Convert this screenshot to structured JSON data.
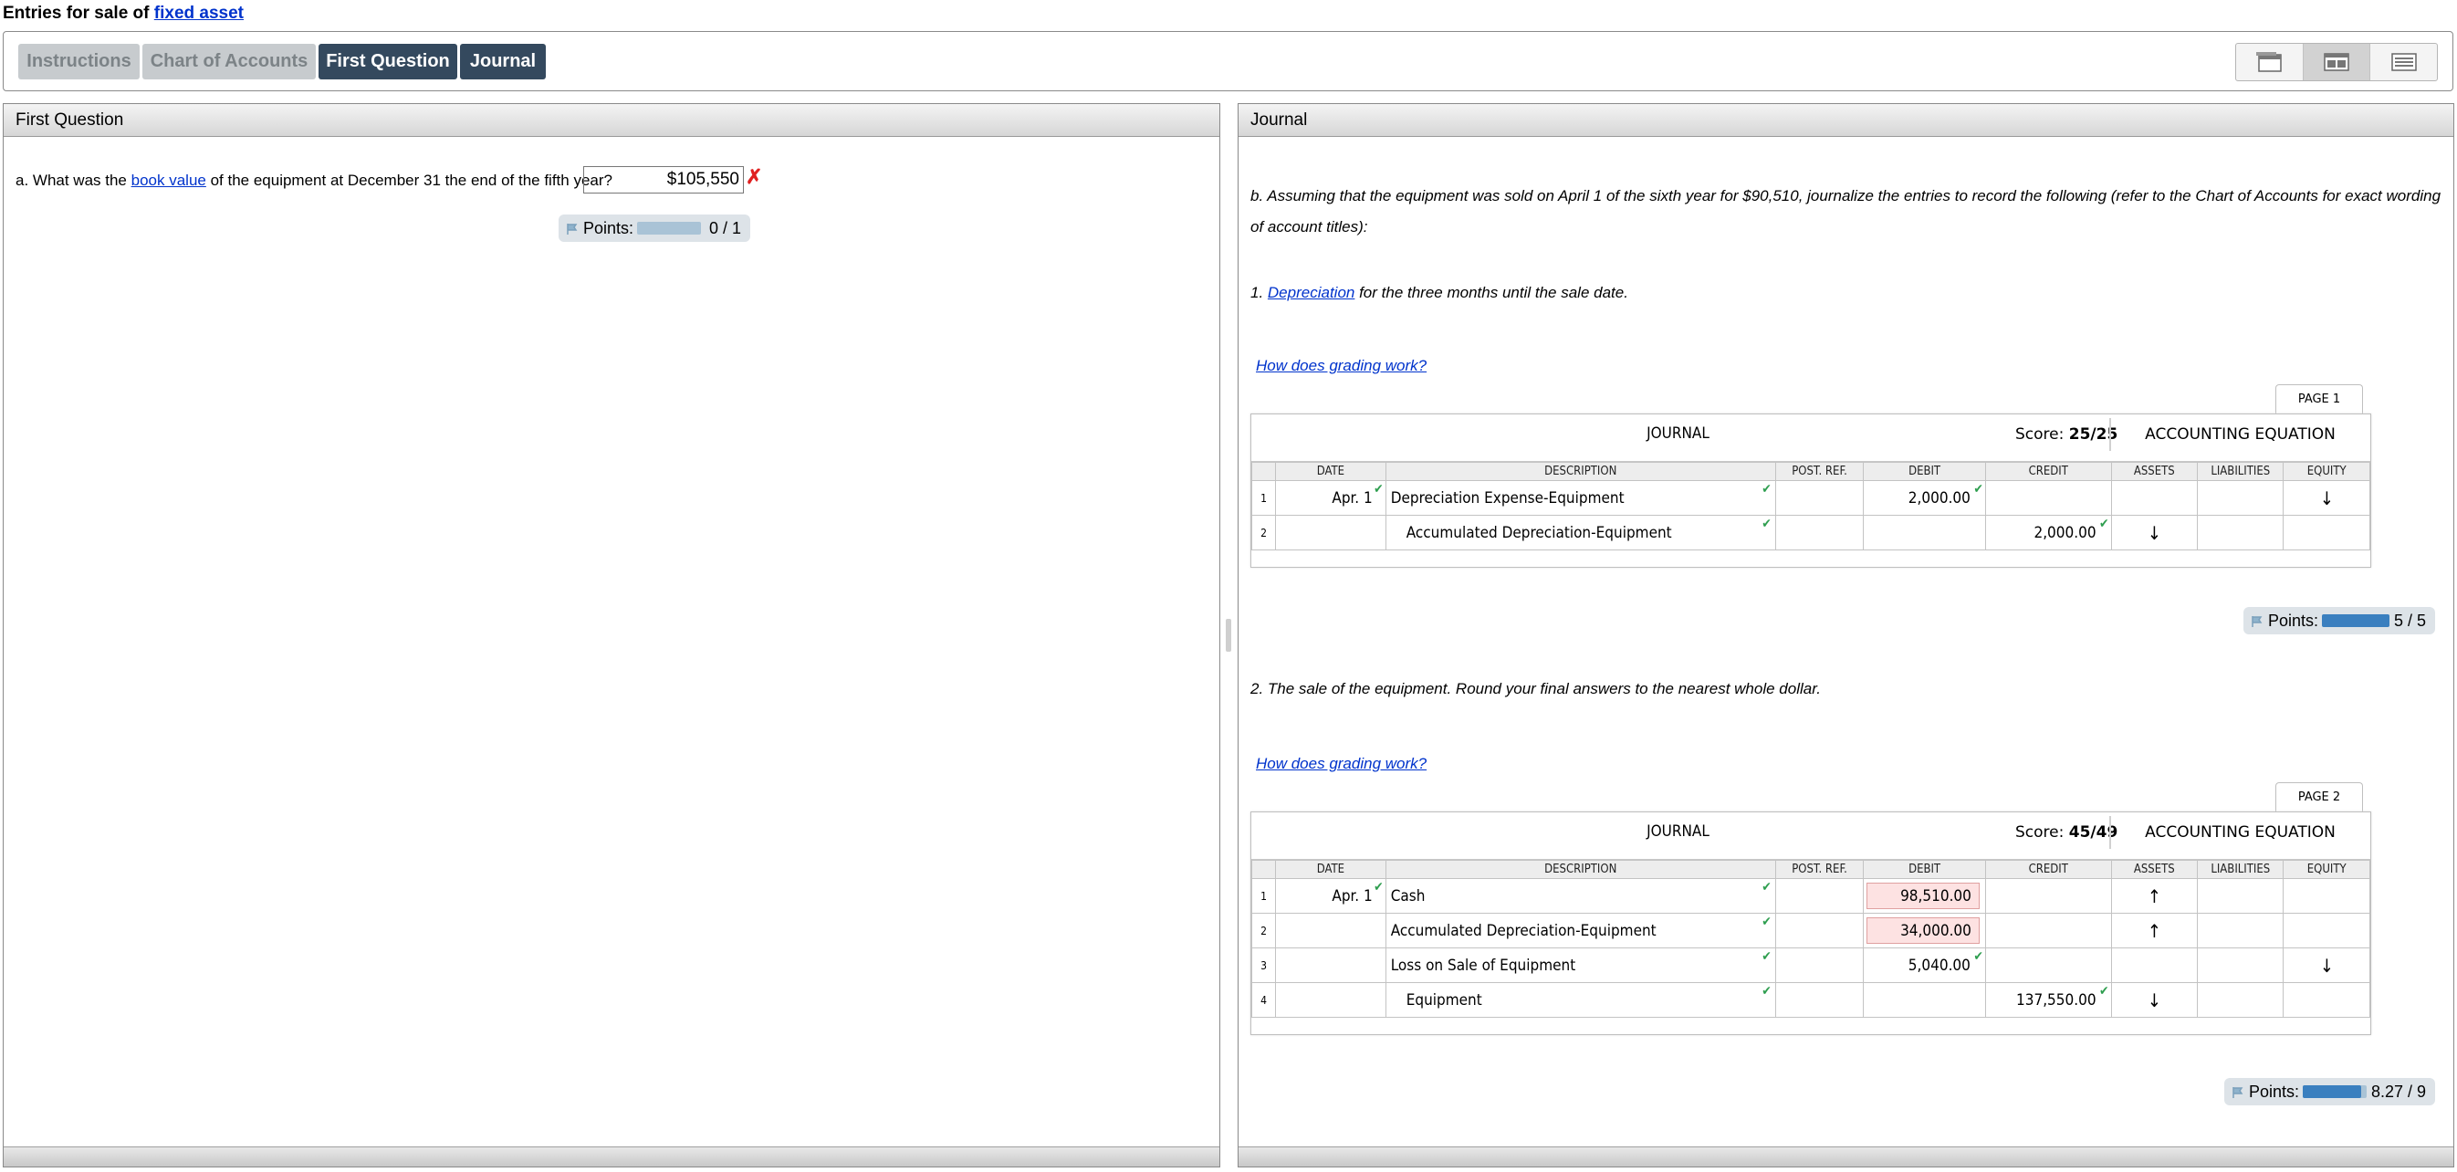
{
  "page": {
    "title_prefix": "Entries for sale of ",
    "title_link": "fixed asset"
  },
  "tabs": [
    {
      "label": "Instructions",
      "state": "inactive"
    },
    {
      "label": "Chart of Accounts",
      "state": "inactive"
    },
    {
      "label": "First Question",
      "state": "active"
    },
    {
      "label": "Journal",
      "state": "active"
    }
  ],
  "layout_switcher": {
    "options": [
      "window-icon",
      "split-view-icon",
      "list-view-icon"
    ],
    "selected": "split-view-icon"
  },
  "left_panel": {
    "header": "First Question",
    "question": {
      "prefix": "a. What was the ",
      "link": "book value",
      "suffix": " of the equipment at December 31 the end of the fifth year?",
      "answer": "$105,550",
      "status": "incorrect"
    },
    "points": {
      "label": "Points:",
      "score": "0 / 1",
      "fraction": 0
    }
  },
  "right_panel": {
    "header": "Journal",
    "intro": "b. Assuming that the equipment was sold on April 1 of the sixth year for $90,510, journalize the entries to record the following (refer to the Chart of Accounts for exact wording of account titles):",
    "part1": {
      "prefix": "1. ",
      "link": "Depreciation",
      "suffix": " for the three months until the sale date.",
      "grading_link": "How does grading work?",
      "page_tab": "PAGE 1",
      "journal_title": "JOURNAL",
      "score_label": "Score:",
      "score": "25/25",
      "equation_label": "ACCOUNTING EQUATION",
      "columns": [
        "DATE",
        "DESCRIPTION",
        "POST. REF.",
        "DEBIT",
        "CREDIT",
        "ASSETS",
        "LIABILITIES",
        "EQUITY"
      ],
      "rows": [
        {
          "num": "1",
          "date": "Apr. 1",
          "desc": "Depreciation Expense-Equipment",
          "indent": false,
          "debit": "2,000.00",
          "credit": "",
          "assets": "",
          "liab": "",
          "equity": "↓",
          "debit_wrong": false
        },
        {
          "num": "2",
          "date": "",
          "desc": "Accumulated Depreciation-Equipment",
          "indent": true,
          "debit": "",
          "credit": "2,000.00",
          "assets": "↓",
          "liab": "",
          "equity": "",
          "debit_wrong": false
        }
      ],
      "points": {
        "label": "Points:",
        "score": "5 / 5",
        "fraction": 1.0
      }
    },
    "part2": {
      "text": "2. The sale of the equipment. Round your final answers to the nearest whole dollar.",
      "grading_link": "How does grading work?",
      "page_tab": "PAGE 2",
      "journal_title": "JOURNAL",
      "score_label": "Score:",
      "score": "45/49",
      "equation_label": "ACCOUNTING EQUATION",
      "columns": [
        "DATE",
        "DESCRIPTION",
        "POST. REF.",
        "DEBIT",
        "CREDIT",
        "ASSETS",
        "LIABILITIES",
        "EQUITY"
      ],
      "rows": [
        {
          "num": "1",
          "date": "Apr. 1",
          "desc": "Cash",
          "indent": false,
          "debit": "98,510.00",
          "credit": "",
          "assets": "↑",
          "liab": "",
          "equity": "",
          "debit_wrong": true
        },
        {
          "num": "2",
          "date": "",
          "desc": "Accumulated Depreciation-Equipment",
          "indent": false,
          "debit": "34,000.00",
          "credit": "",
          "assets": "↑",
          "liab": "",
          "equity": "",
          "debit_wrong": true
        },
        {
          "num": "3",
          "date": "",
          "desc": "Loss on Sale of Equipment",
          "indent": false,
          "debit": "5,040.00",
          "credit": "",
          "assets": "",
          "liab": "",
          "equity": "↓",
          "debit_wrong": false
        },
        {
          "num": "4",
          "date": "",
          "desc": "Equipment",
          "indent": true,
          "debit": "",
          "credit": "137,550.00",
          "assets": "↓",
          "liab": "",
          "equity": "",
          "debit_wrong": false
        }
      ],
      "points": {
        "label": "Points:",
        "score": "8.27 / 9",
        "fraction": 0.92
      }
    }
  },
  "colors": {
    "active_tab": "#34495e",
    "inactive_tab": "#c7cbce",
    "check": "#2e9e4f",
    "error": "#e02020",
    "points_fill": "#3a7fbf",
    "points_empty": "#a9c3d6",
    "link": "#0033cc"
  }
}
